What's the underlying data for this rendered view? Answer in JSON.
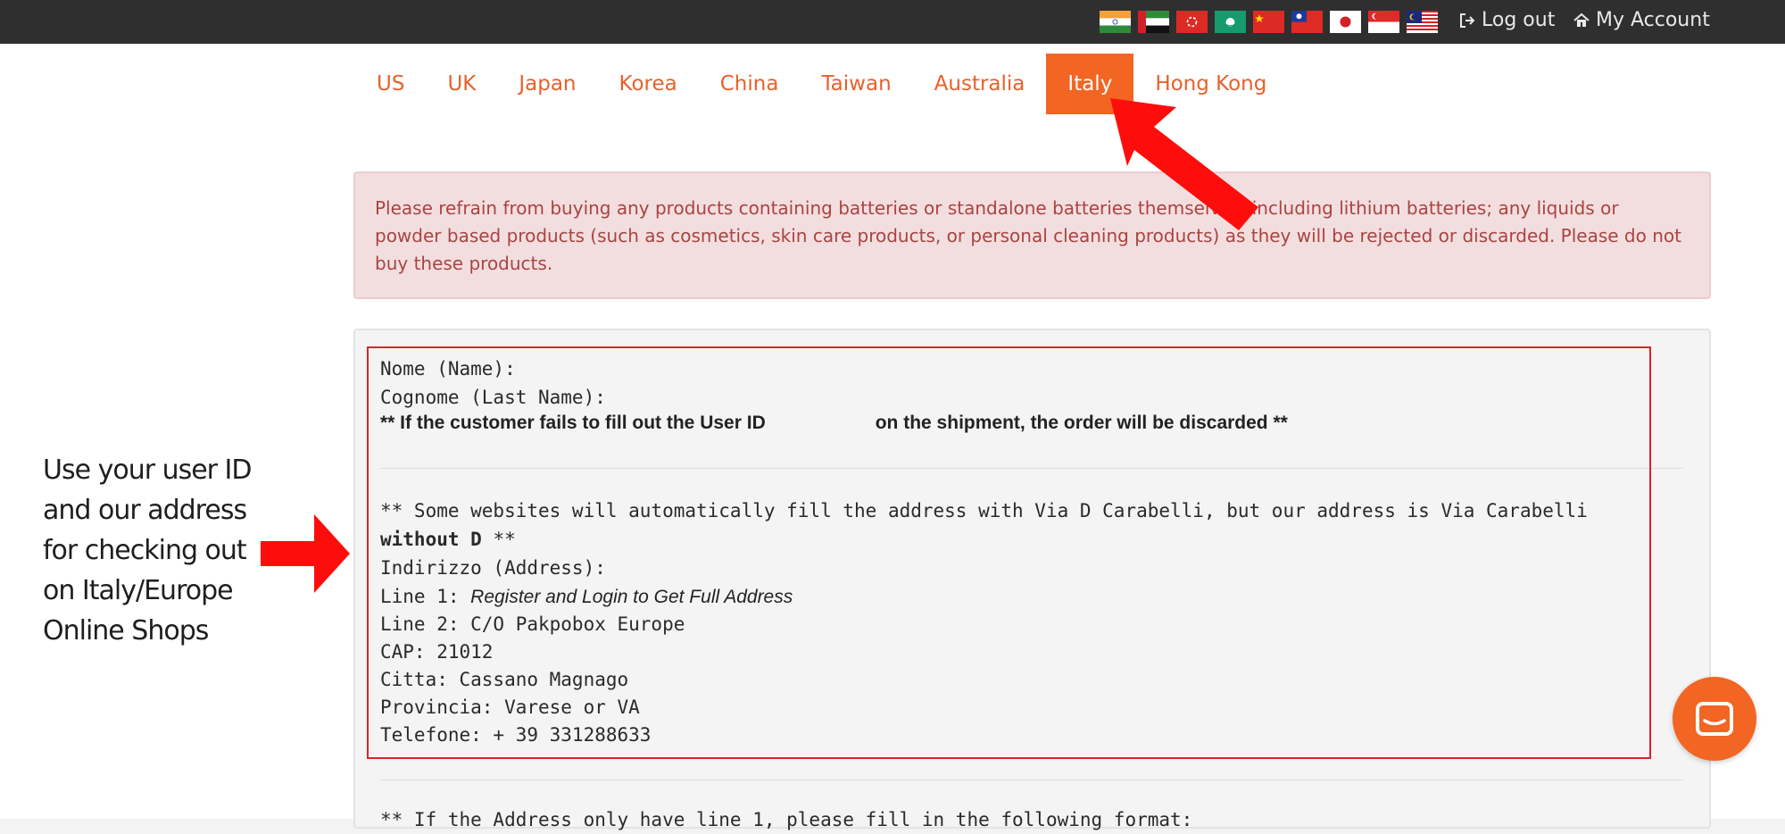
{
  "topbar": {
    "flags": [
      "india-flag",
      "uae-flag",
      "hong-kong-flag",
      "macau-flag",
      "china-flag",
      "taiwan-flag",
      "japan-flag",
      "singapore-flag",
      "malaysia-flag"
    ],
    "logout_label": "Log out",
    "account_label": "My Account"
  },
  "tabs": [
    {
      "label": "US"
    },
    {
      "label": "UK"
    },
    {
      "label": "Japan"
    },
    {
      "label": "Korea"
    },
    {
      "label": "China"
    },
    {
      "label": "Taiwan"
    },
    {
      "label": "Australia"
    },
    {
      "label": "Italy",
      "active": true
    },
    {
      "label": "Hong Kong"
    }
  ],
  "alert": {
    "text": "Please refrain from buying any products containing batteries or standalone batteries themselves, including lithium batteries; any liquids or powder based products (such as cosmetics, skin care products, or personal cleaning products) as they will be rejected or discarded. Please do not buy these products."
  },
  "address": {
    "name_label": "Nome (Name):",
    "last_name_label": "Cognome (Last Name):",
    "warning_part1": "** If the customer fails to fill out the User ID",
    "warning_part2": "on the shipment, the order will be discarded **",
    "note_line1": "** Some websites will automatically fill the address with Via D Carabelli, but our address is Via Carabelli",
    "note_line2_bold": "without D",
    "note_line2_tail": " **",
    "address_label": "Indirizzo (Address):",
    "line1_label": "Line 1: ",
    "line1_value": "Register and Login to Get Full Address",
    "line2": "Line 2: C/O Pakpobox Europe",
    "cap": "CAP: 21012",
    "citta": "Citta: Cassano Magnago",
    "provincia": "Provincia: Varese or VA",
    "telefone": "Telefone: + 39 331288633",
    "next_line": "** If the Address only have line 1, please fill in the following format:"
  },
  "sidenote": {
    "text": "Use your user ID and our address for checking out on Italy/Europe Online Shops"
  },
  "colors": {
    "accent": "#f26522",
    "alert_text": "#a94442",
    "highlight_red": "#e0202a"
  }
}
